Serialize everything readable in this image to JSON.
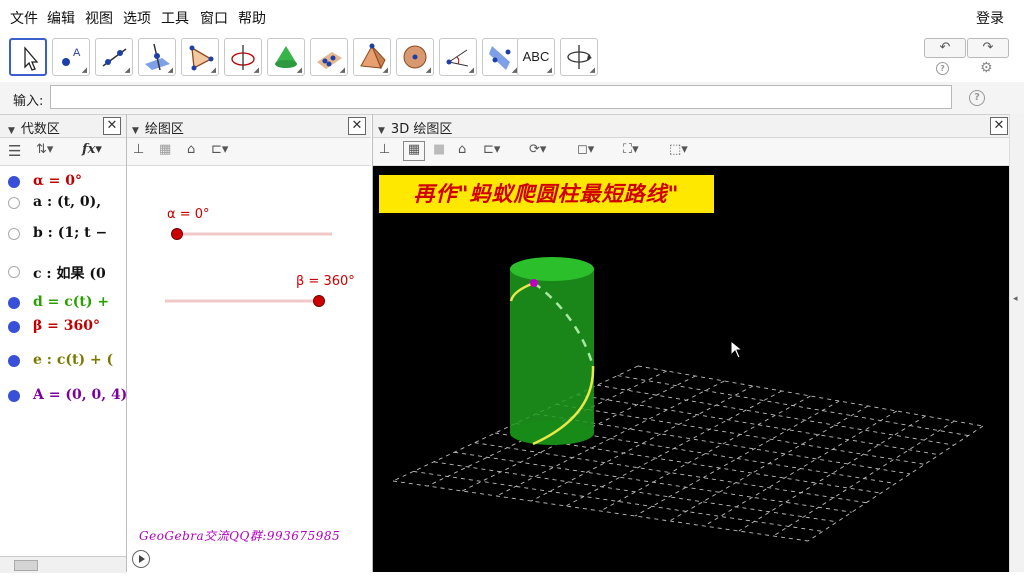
{
  "menu": {
    "items": [
      "文件",
      "编辑",
      "视图",
      "选项",
      "工具",
      "窗口",
      "帮助"
    ],
    "login": "登录"
  },
  "toolbar": {
    "tools": [
      "move-tool",
      "point-tool",
      "line-tool",
      "perpendicular-line-tool",
      "polygon-tool",
      "circle-axis-tool",
      "cone-tool",
      "plane-points-tool",
      "pyramid-tool",
      "sphere-tool",
      "angle-tool",
      "reflect-tool",
      "text-tool",
      "rotate-view-tool"
    ],
    "text_tool_label": "ABC"
  },
  "input": {
    "label": "输入:",
    "value": ""
  },
  "panels": {
    "algebra_title": "代数区",
    "graphics_title": "绘图区",
    "graphics3d_title": "3D 绘图区"
  },
  "algebra": {
    "rows": [
      {
        "text": "α = 0°",
        "color": "#c00000",
        "dot": "#3a4fd8",
        "filled": true
      },
      {
        "text": "a : (t, 0),",
        "color": "#111111",
        "dot": "#ffffff",
        "filled": false
      },
      {
        "text": "b : (1; t −",
        "color": "#111111",
        "dot": "#ffffff",
        "filled": false
      },
      {
        "text": "c : 如果 (0",
        "color": "#111111",
        "dot": "#ffffff",
        "filled": false
      },
      {
        "text": "d = c(t) +",
        "color": "#2aa000",
        "dot": "#3a4fd8",
        "filled": true
      },
      {
        "text": "β = 360°",
        "color": "#c00000",
        "dot": "#3a4fd8",
        "filled": true
      },
      {
        "text": "e : c(t) + (",
        "color": "#7a7a00",
        "dot": "#3a4fd8",
        "filled": true
      },
      {
        "text": "A = (0, 0, 4)",
        "color": "#7a00a0",
        "dot": "#3a4fd8",
        "filled": true
      }
    ]
  },
  "graphics": {
    "slider_alpha_label": "α = 0°",
    "slider_alpha_value": 0,
    "slider_beta_label": "β = 360°",
    "slider_beta_value": 1,
    "watermark": "GeoGebra交流QQ群:993675985"
  },
  "graphics3d": {
    "banner": "再作\"蚂蚁爬圆柱最短路线\""
  },
  "colors": {
    "slider_red": "#cc0000",
    "cylinder_green": "#1fa51f",
    "curve_yellow": "#e8e84a",
    "point_magenta": "#c000c0",
    "banner_yellow": "#ffe800"
  }
}
